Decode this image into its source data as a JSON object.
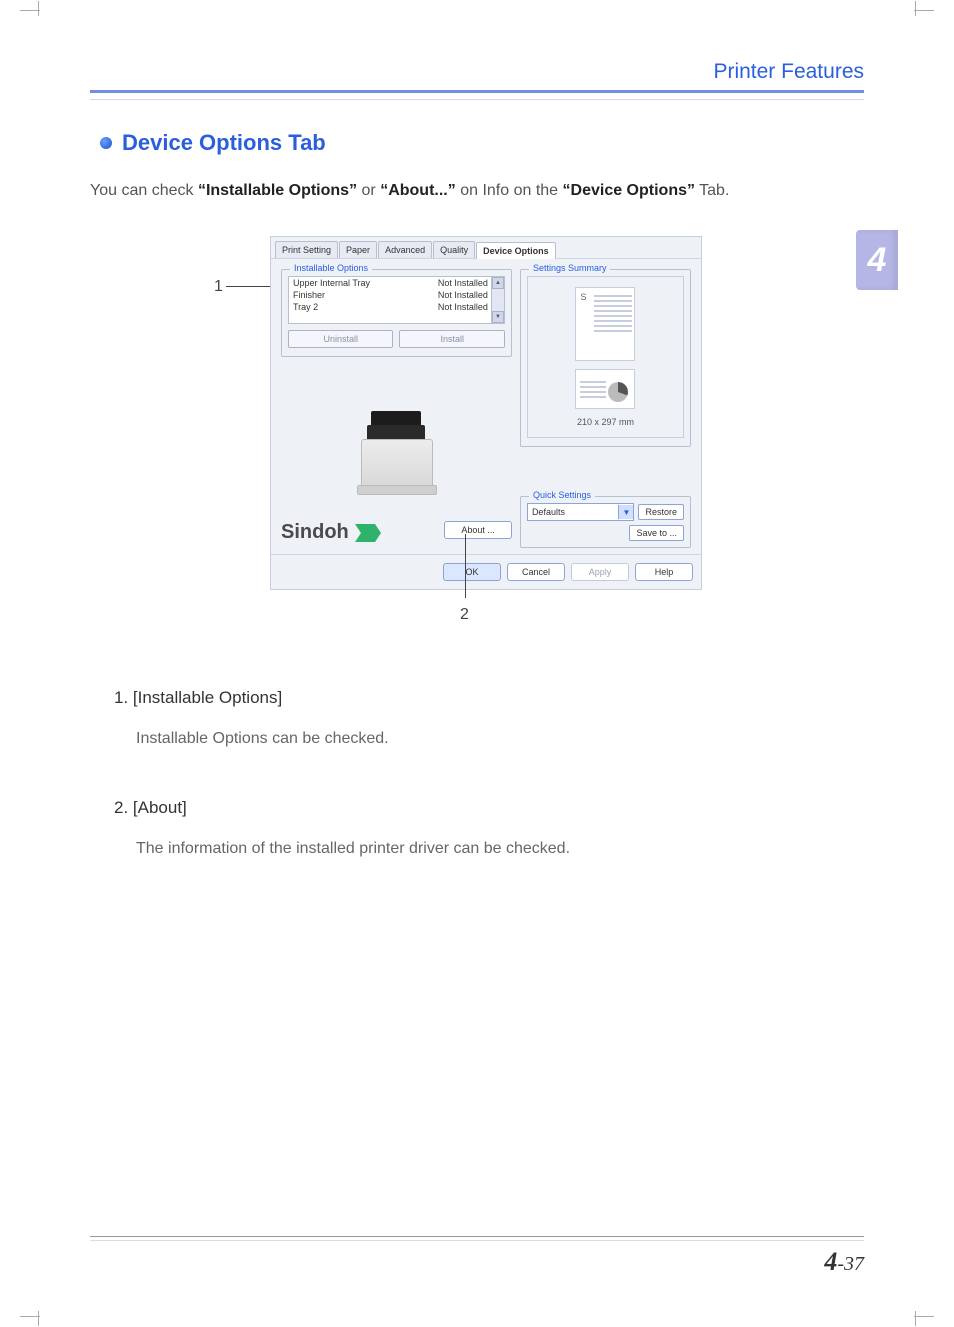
{
  "header": {
    "title": "Printer Features"
  },
  "chapter": {
    "number": "4"
  },
  "section": {
    "title": "Device Options Tab"
  },
  "intro": {
    "pre": "You can check ",
    "q1": "“Installable Options”",
    "mid1": " or ",
    "q2": "“About...”",
    "mid2": " on Info on the ",
    "q3": "“Device Options”",
    "post": " Tab."
  },
  "callouts": {
    "one": "1",
    "two": "2"
  },
  "dialog": {
    "tabs": {
      "print_setting": "Print Setting",
      "paper": "Paper",
      "advanced": "Advanced",
      "quality": "Quality",
      "device_options": "Device Options"
    },
    "installable": {
      "group_title": "Installable Options",
      "rows": [
        {
          "name": "Upper Internal Tray",
          "status": "Not Installed"
        },
        {
          "name": "Finisher",
          "status": "Not Installed"
        },
        {
          "name": "Tray 2",
          "status": "Not Installed"
        }
      ],
      "uninstall": "Uninstall",
      "install": "Install"
    },
    "brand": "Sindoh",
    "about": "About ...",
    "settings_summary": {
      "title": "Settings Summary",
      "s_label": "S",
      "dimensions": "210 x 297 mm"
    },
    "quick": {
      "title": "Quick Settings",
      "selected": "Defaults",
      "restore": "Restore",
      "save": "Save to ..."
    },
    "footer": {
      "ok": "OK",
      "cancel": "Cancel",
      "apply": "Apply",
      "help": "Help"
    }
  },
  "descriptions": {
    "item1_h": "1. [Installable Options]",
    "item1_p": "Installable Options can be checked.",
    "item2_h": "2. [About]",
    "item2_p": "The information of the installed printer driver can be checked."
  },
  "page_number": {
    "chapter": "4",
    "sep": "-",
    "page": "37"
  }
}
